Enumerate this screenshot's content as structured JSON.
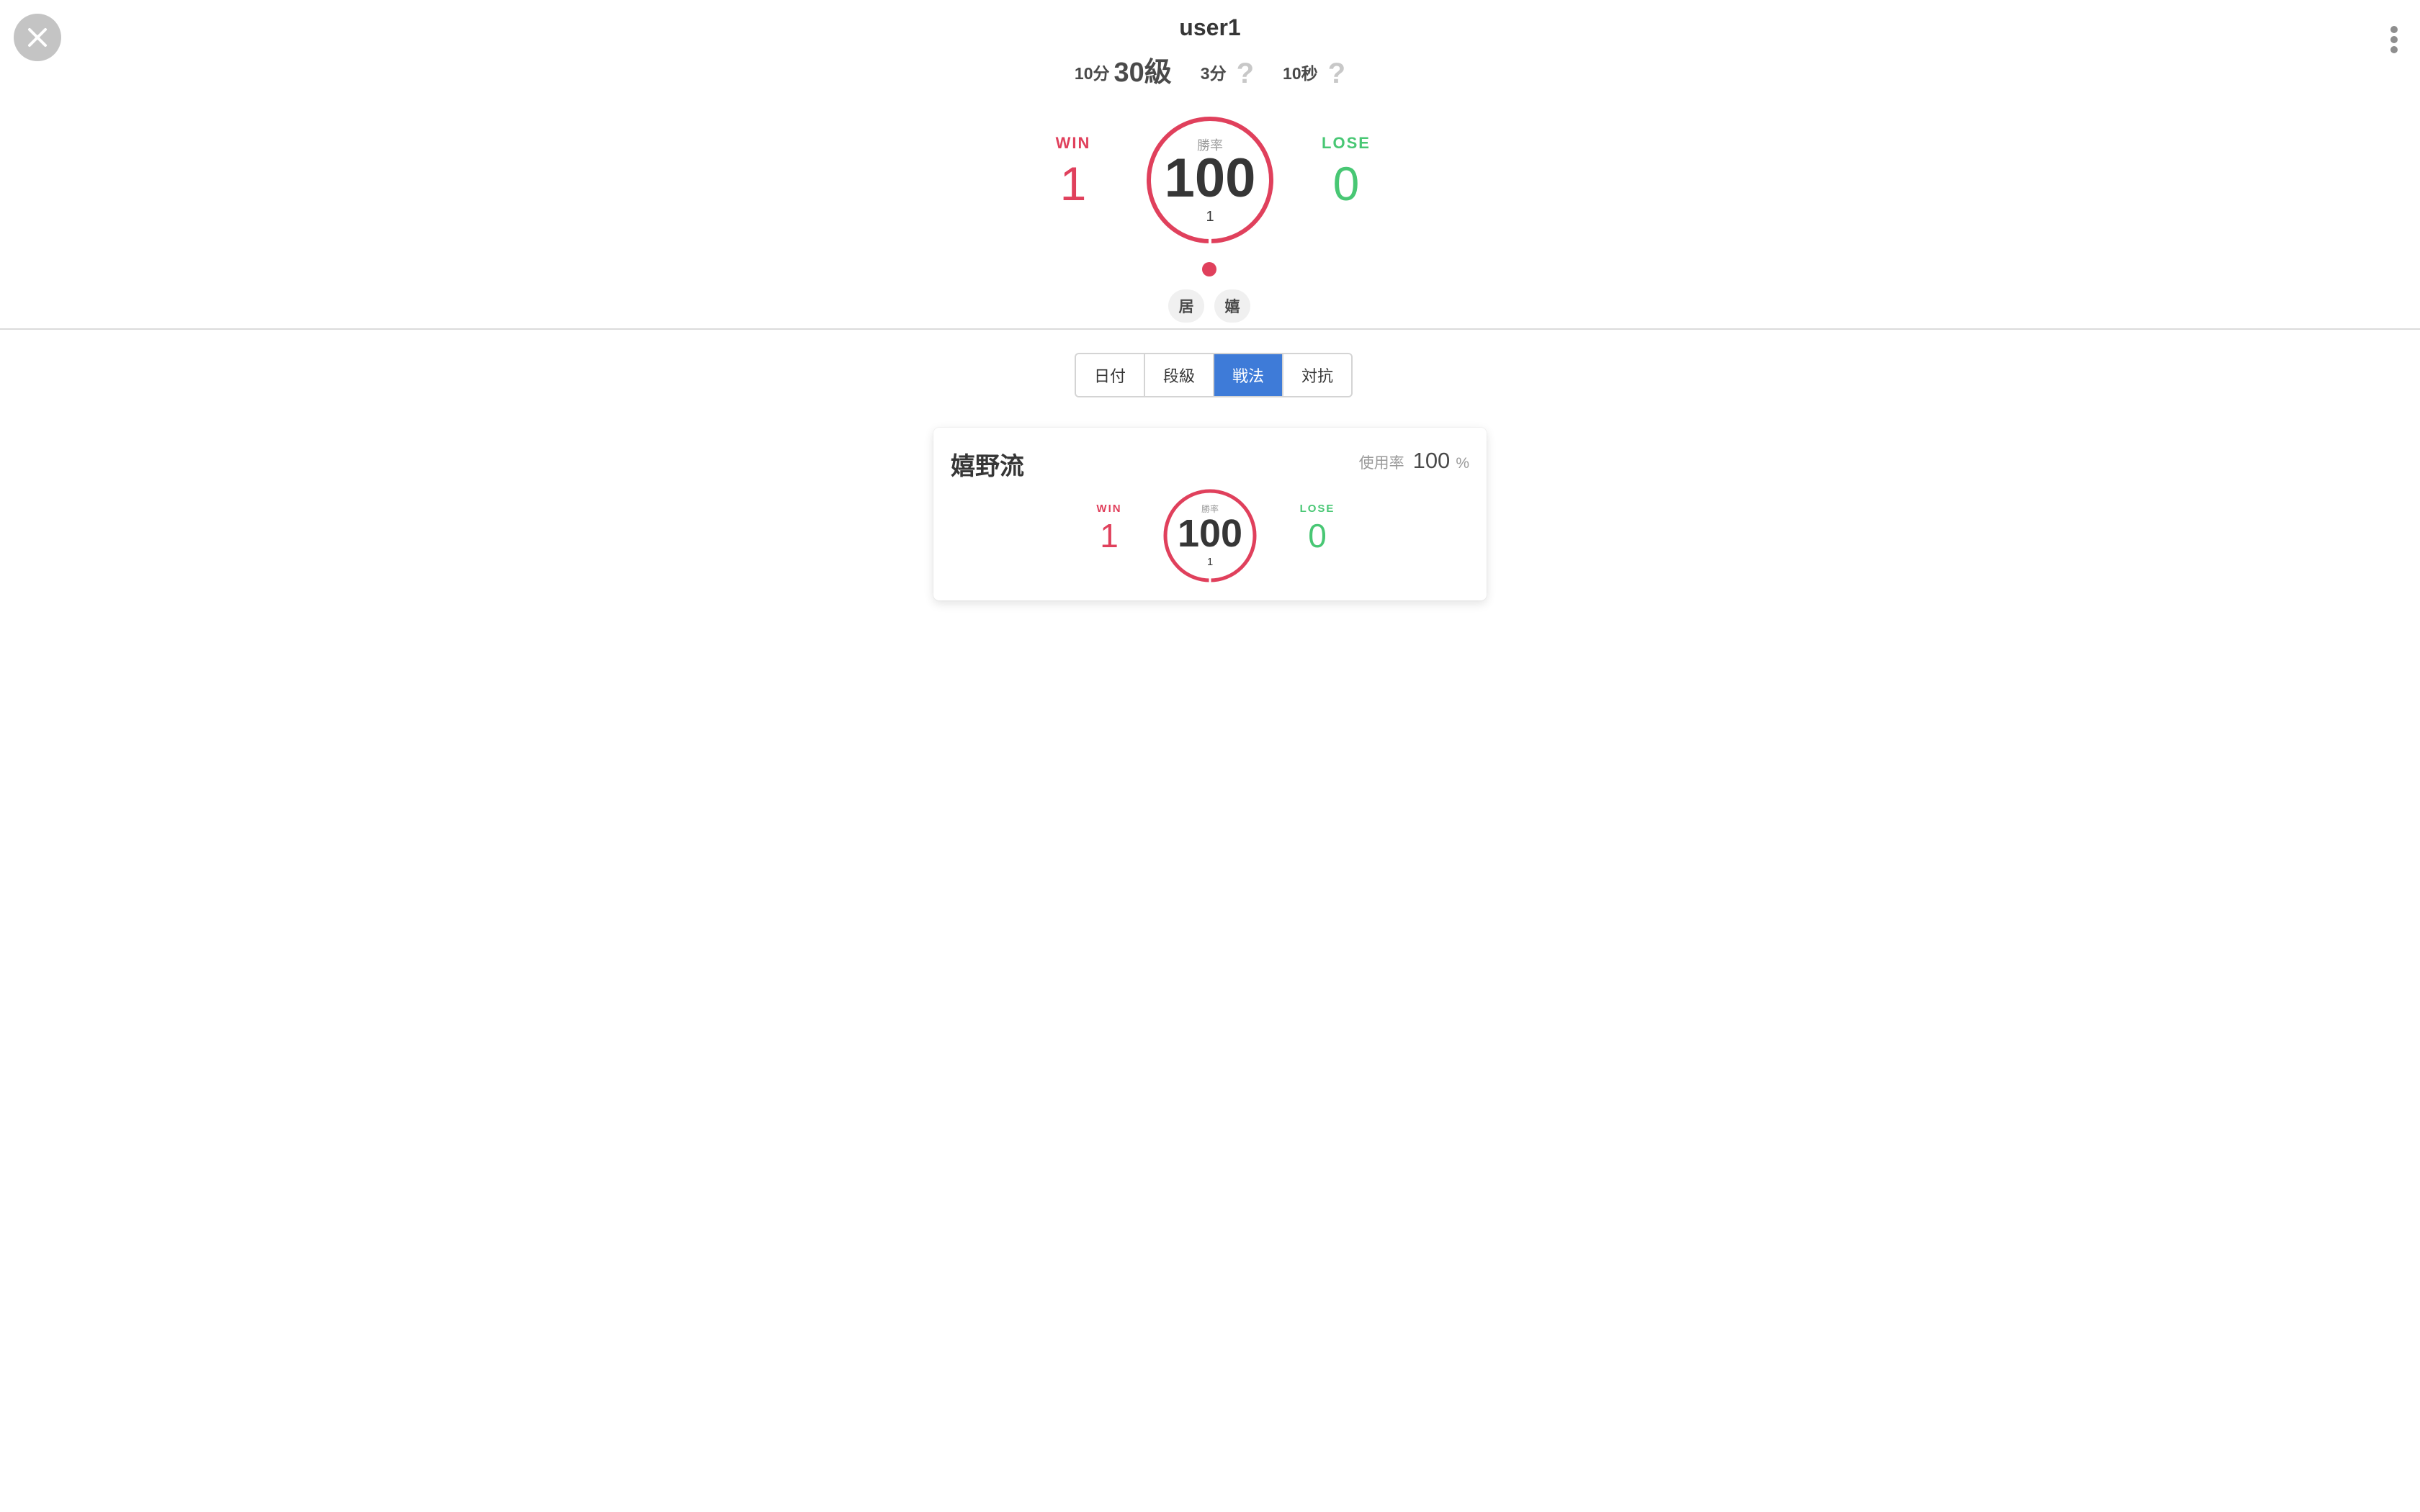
{
  "header": {
    "user_name": "user1",
    "ranks": [
      {
        "rule": "10分",
        "value": "30級"
      },
      {
        "rule": "3分",
        "value": "?"
      },
      {
        "rule": "10秒",
        "value": "?"
      }
    ]
  },
  "summary": {
    "win_label": "WIN",
    "win_count": "1",
    "lose_label": "LOSE",
    "lose_count": "0",
    "ratio_label": "勝率",
    "ratio_value": "100",
    "ratio_sub": "1",
    "win_fraction": 1.0
  },
  "badges": [
    "居",
    "嬉"
  ],
  "tabs": [
    {
      "label": "日付",
      "active": false
    },
    {
      "label": "段級",
      "active": false
    },
    {
      "label": "戦法",
      "active": true
    },
    {
      "label": "対抗",
      "active": false
    }
  ],
  "cards": [
    {
      "title": "嬉野流",
      "usage_label": "使用率",
      "usage_value": "100",
      "usage_unit": "%",
      "win_label": "WIN",
      "win_count": "1",
      "lose_label": "LOSE",
      "lose_count": "0",
      "ratio_label": "勝率",
      "ratio_value": "100",
      "ratio_sub": "1"
    }
  ],
  "colors": {
    "win": "#e0405c",
    "lose": "#48c774",
    "active_tab": "#3e7bd8"
  }
}
